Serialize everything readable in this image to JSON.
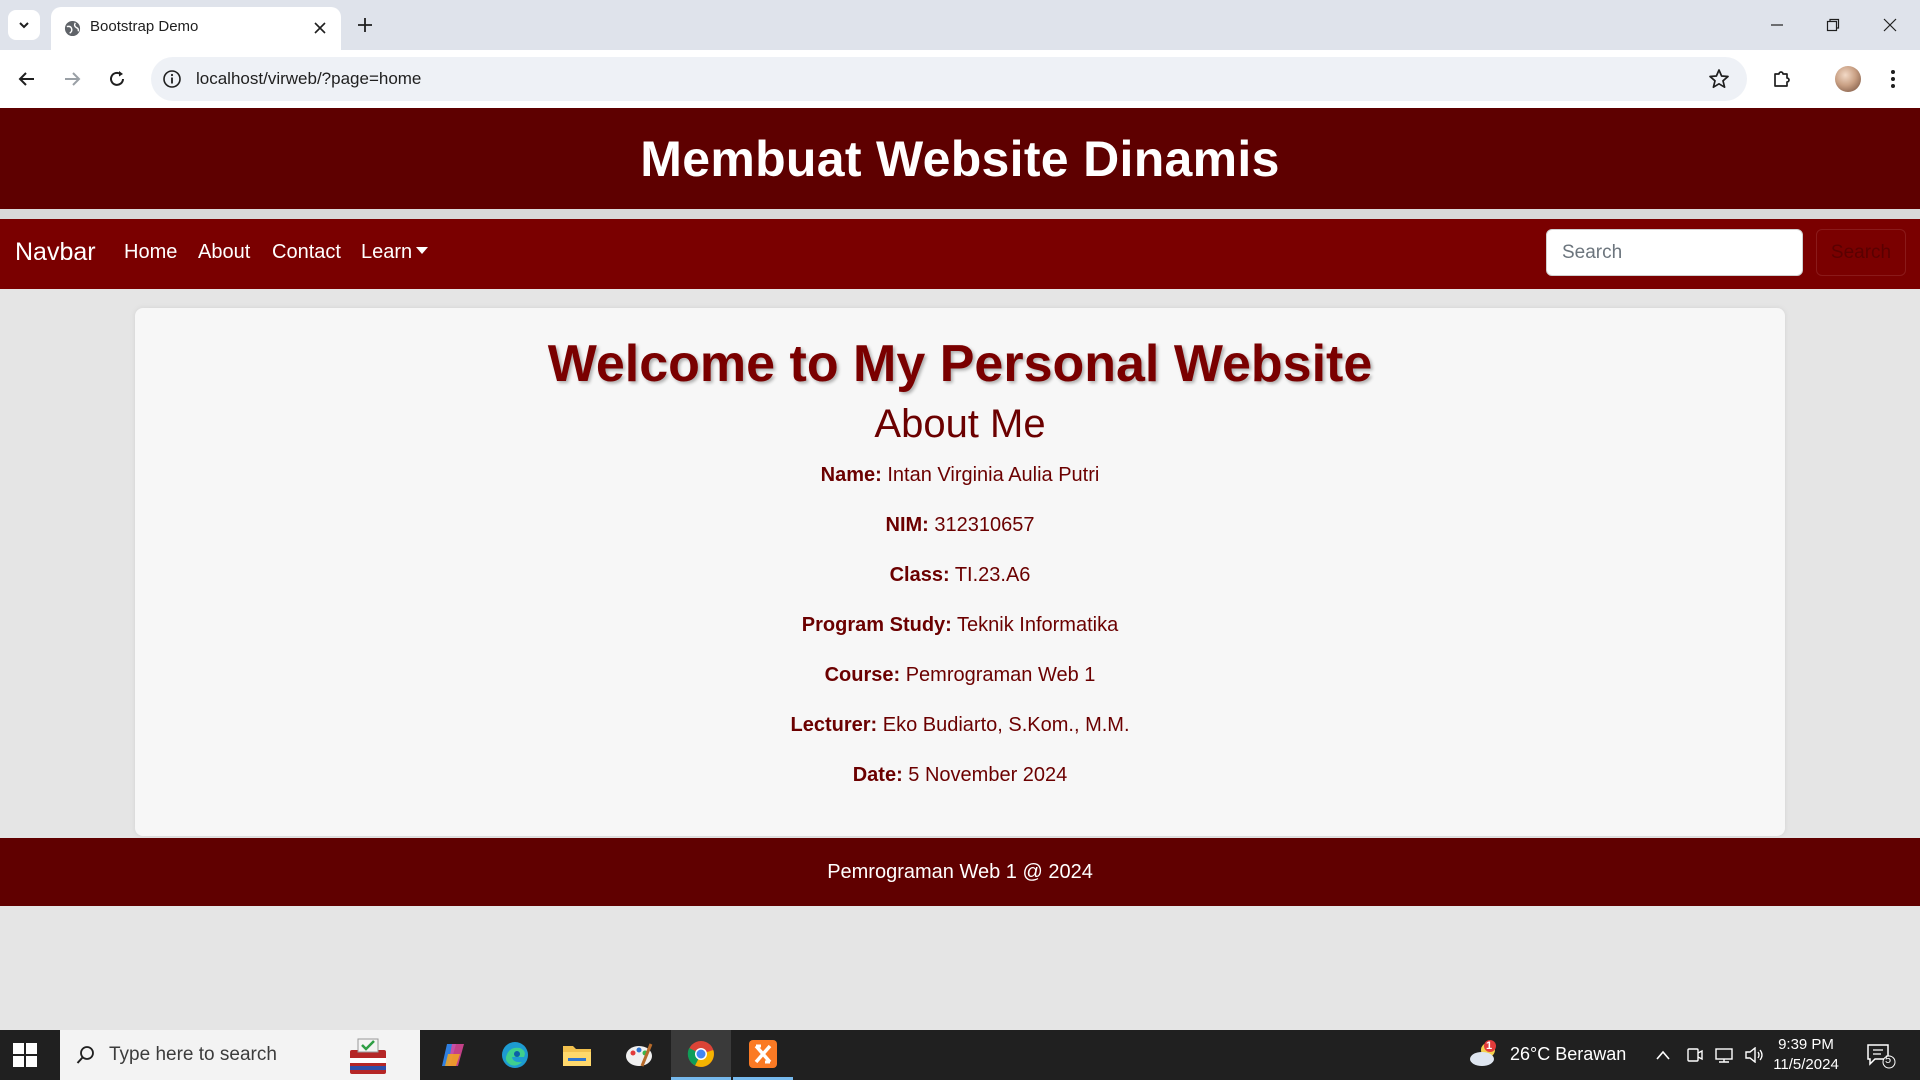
{
  "browser": {
    "tab_title": "Bootstrap Demo",
    "url": "localhost/virweb/?page=home"
  },
  "site": {
    "header_title": "Membuat Website Dinamis",
    "navbar": {
      "brand": "Navbar",
      "links": [
        "Home",
        "About",
        "Contact",
        "Learn"
      ],
      "search_placeholder": "Search",
      "search_button": "Search"
    },
    "welcome": "Welcome to My Personal Website",
    "about_heading": "About Me",
    "info": [
      {
        "label": "Name:",
        "value": "Intan Virginia Aulia Putri"
      },
      {
        "label": "NIM:",
        "value": "312310657"
      },
      {
        "label": "Class:",
        "value": "TI.23.A6"
      },
      {
        "label": "Program Study:",
        "value": "Teknik Informatika"
      },
      {
        "label": "Course:",
        "value": "Pemrograman Web 1"
      },
      {
        "label": "Lecturer:",
        "value": "Eko Budiarto, S.Kom., M.M."
      },
      {
        "label": "Date:",
        "value": "5 November 2024"
      }
    ],
    "footer": "Pemrograman Web 1 @ 2024"
  },
  "taskbar": {
    "search_text": "Type here to search",
    "weather": "26°C  Berawan",
    "weather_badge": "1",
    "time": "9:39 PM",
    "date": "11/5/2024",
    "notification_count": "5"
  },
  "colors": {
    "header": "#5e0000",
    "navbar": "#7a0000",
    "accent_text": "#7a0000",
    "footer": "#600000"
  }
}
